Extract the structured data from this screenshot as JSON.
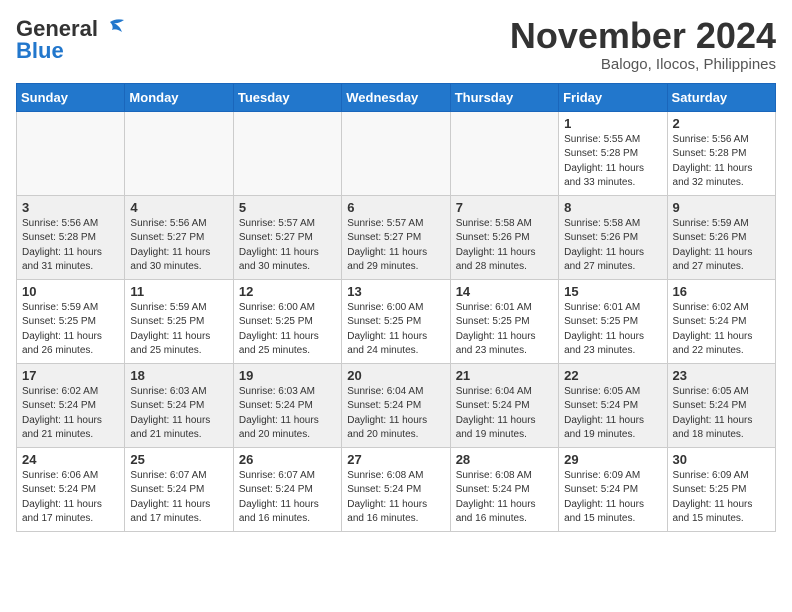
{
  "header": {
    "logo_general": "General",
    "logo_blue": "Blue",
    "month_title": "November 2024",
    "location": "Balogo, Ilocos, Philippines"
  },
  "weekdays": [
    "Sunday",
    "Monday",
    "Tuesday",
    "Wednesday",
    "Thursday",
    "Friday",
    "Saturday"
  ],
  "weeks": [
    [
      {
        "day": "",
        "empty": true
      },
      {
        "day": "",
        "empty": true
      },
      {
        "day": "",
        "empty": true
      },
      {
        "day": "",
        "empty": true
      },
      {
        "day": "",
        "empty": true
      },
      {
        "day": "1",
        "sunrise": "Sunrise: 5:55 AM",
        "sunset": "Sunset: 5:28 PM",
        "daylight": "Daylight: 11 hours and 33 minutes."
      },
      {
        "day": "2",
        "sunrise": "Sunrise: 5:56 AM",
        "sunset": "Sunset: 5:28 PM",
        "daylight": "Daylight: 11 hours and 32 minutes."
      }
    ],
    [
      {
        "day": "3",
        "sunrise": "Sunrise: 5:56 AM",
        "sunset": "Sunset: 5:28 PM",
        "daylight": "Daylight: 11 hours and 31 minutes."
      },
      {
        "day": "4",
        "sunrise": "Sunrise: 5:56 AM",
        "sunset": "Sunset: 5:27 PM",
        "daylight": "Daylight: 11 hours and 30 minutes."
      },
      {
        "day": "5",
        "sunrise": "Sunrise: 5:57 AM",
        "sunset": "Sunset: 5:27 PM",
        "daylight": "Daylight: 11 hours and 30 minutes."
      },
      {
        "day": "6",
        "sunrise": "Sunrise: 5:57 AM",
        "sunset": "Sunset: 5:27 PM",
        "daylight": "Daylight: 11 hours and 29 minutes."
      },
      {
        "day": "7",
        "sunrise": "Sunrise: 5:58 AM",
        "sunset": "Sunset: 5:26 PM",
        "daylight": "Daylight: 11 hours and 28 minutes."
      },
      {
        "day": "8",
        "sunrise": "Sunrise: 5:58 AM",
        "sunset": "Sunset: 5:26 PM",
        "daylight": "Daylight: 11 hours and 27 minutes."
      },
      {
        "day": "9",
        "sunrise": "Sunrise: 5:59 AM",
        "sunset": "Sunset: 5:26 PM",
        "daylight": "Daylight: 11 hours and 27 minutes."
      }
    ],
    [
      {
        "day": "10",
        "sunrise": "Sunrise: 5:59 AM",
        "sunset": "Sunset: 5:25 PM",
        "daylight": "Daylight: 11 hours and 26 minutes."
      },
      {
        "day": "11",
        "sunrise": "Sunrise: 5:59 AM",
        "sunset": "Sunset: 5:25 PM",
        "daylight": "Daylight: 11 hours and 25 minutes."
      },
      {
        "day": "12",
        "sunrise": "Sunrise: 6:00 AM",
        "sunset": "Sunset: 5:25 PM",
        "daylight": "Daylight: 11 hours and 25 minutes."
      },
      {
        "day": "13",
        "sunrise": "Sunrise: 6:00 AM",
        "sunset": "Sunset: 5:25 PM",
        "daylight": "Daylight: 11 hours and 24 minutes."
      },
      {
        "day": "14",
        "sunrise": "Sunrise: 6:01 AM",
        "sunset": "Sunset: 5:25 PM",
        "daylight": "Daylight: 11 hours and 23 minutes."
      },
      {
        "day": "15",
        "sunrise": "Sunrise: 6:01 AM",
        "sunset": "Sunset: 5:25 PM",
        "daylight": "Daylight: 11 hours and 23 minutes."
      },
      {
        "day": "16",
        "sunrise": "Sunrise: 6:02 AM",
        "sunset": "Sunset: 5:24 PM",
        "daylight": "Daylight: 11 hours and 22 minutes."
      }
    ],
    [
      {
        "day": "17",
        "sunrise": "Sunrise: 6:02 AM",
        "sunset": "Sunset: 5:24 PM",
        "daylight": "Daylight: 11 hours and 21 minutes."
      },
      {
        "day": "18",
        "sunrise": "Sunrise: 6:03 AM",
        "sunset": "Sunset: 5:24 PM",
        "daylight": "Daylight: 11 hours and 21 minutes."
      },
      {
        "day": "19",
        "sunrise": "Sunrise: 6:03 AM",
        "sunset": "Sunset: 5:24 PM",
        "daylight": "Daylight: 11 hours and 20 minutes."
      },
      {
        "day": "20",
        "sunrise": "Sunrise: 6:04 AM",
        "sunset": "Sunset: 5:24 PM",
        "daylight": "Daylight: 11 hours and 20 minutes."
      },
      {
        "day": "21",
        "sunrise": "Sunrise: 6:04 AM",
        "sunset": "Sunset: 5:24 PM",
        "daylight": "Daylight: 11 hours and 19 minutes."
      },
      {
        "day": "22",
        "sunrise": "Sunrise: 6:05 AM",
        "sunset": "Sunset: 5:24 PM",
        "daylight": "Daylight: 11 hours and 19 minutes."
      },
      {
        "day": "23",
        "sunrise": "Sunrise: 6:05 AM",
        "sunset": "Sunset: 5:24 PM",
        "daylight": "Daylight: 11 hours and 18 minutes."
      }
    ],
    [
      {
        "day": "24",
        "sunrise": "Sunrise: 6:06 AM",
        "sunset": "Sunset: 5:24 PM",
        "daylight": "Daylight: 11 hours and 17 minutes."
      },
      {
        "day": "25",
        "sunrise": "Sunrise: 6:07 AM",
        "sunset": "Sunset: 5:24 PM",
        "daylight": "Daylight: 11 hours and 17 minutes."
      },
      {
        "day": "26",
        "sunrise": "Sunrise: 6:07 AM",
        "sunset": "Sunset: 5:24 PM",
        "daylight": "Daylight: 11 hours and 16 minutes."
      },
      {
        "day": "27",
        "sunrise": "Sunrise: 6:08 AM",
        "sunset": "Sunset: 5:24 PM",
        "daylight": "Daylight: 11 hours and 16 minutes."
      },
      {
        "day": "28",
        "sunrise": "Sunrise: 6:08 AM",
        "sunset": "Sunset: 5:24 PM",
        "daylight": "Daylight: 11 hours and 16 minutes."
      },
      {
        "day": "29",
        "sunrise": "Sunrise: 6:09 AM",
        "sunset": "Sunset: 5:24 PM",
        "daylight": "Daylight: 11 hours and 15 minutes."
      },
      {
        "day": "30",
        "sunrise": "Sunrise: 6:09 AM",
        "sunset": "Sunset: 5:25 PM",
        "daylight": "Daylight: 11 hours and 15 minutes."
      }
    ]
  ]
}
